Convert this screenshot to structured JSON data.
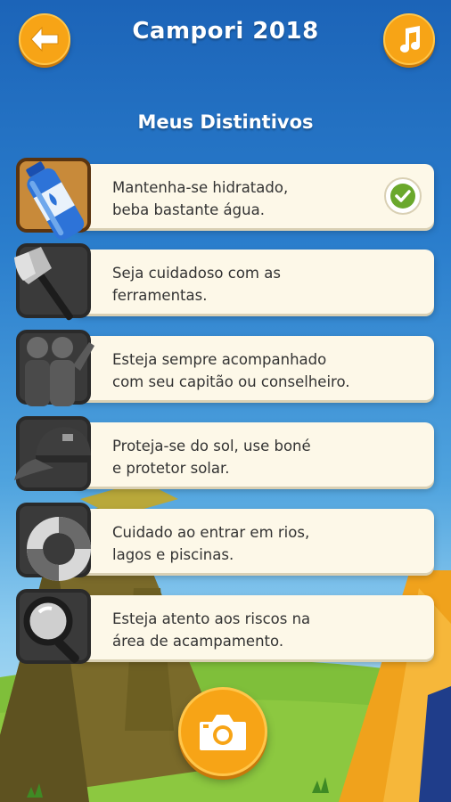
{
  "header": {
    "title": "Campori 2018",
    "back_icon": "arrow-left-icon",
    "music_icon": "music-note-icon"
  },
  "page": {
    "subtitle": "Meus Distintivos"
  },
  "badges": [
    {
      "icon": "water-bottle-icon",
      "line1": "Mantenha-se hidratado,",
      "line2": "beba bastante água.",
      "earned": true
    },
    {
      "icon": "axe-icon",
      "line1": "Seja cuidadoso com as",
      "line2": "ferramentas.",
      "earned": false
    },
    {
      "icon": "people-group-icon",
      "line1": "Esteja sempre acompanhado",
      "line2": "com seu capitão ou conselheiro.",
      "earned": false
    },
    {
      "icon": "cap-icon",
      "line1": "Proteja-se do sol, use boné",
      "line2": "e protetor solar.",
      "earned": false
    },
    {
      "icon": "lifebuoy-icon",
      "line1": "Cuidado ao entrar em rios,",
      "line2": "lagos e piscinas.",
      "earned": false
    },
    {
      "icon": "magnifier-icon",
      "line1": "Esteja atento aos riscos na",
      "line2": "área de acampamento.",
      "earned": false
    }
  ],
  "footer": {
    "camera_icon": "camera-icon"
  },
  "colors": {
    "accent": "#f7a416",
    "sky_top": "#1c64b8",
    "card": "#fdf8e8",
    "check": "#6aa82c"
  }
}
